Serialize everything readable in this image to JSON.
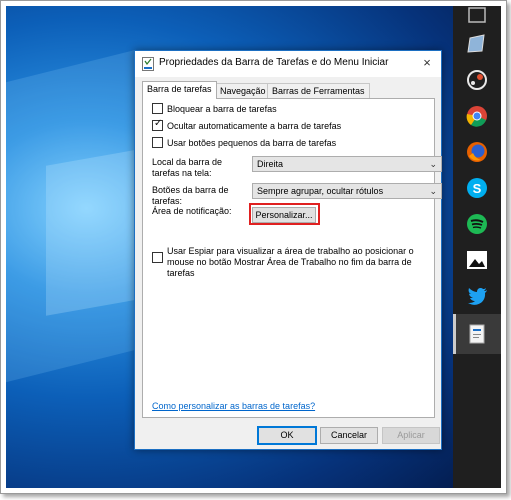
{
  "dialog": {
    "title": "Propriedades da Barra de Tarefas e do Menu Iniciar",
    "close_glyph": "×",
    "tabs": [
      {
        "label": "Barra de tarefas",
        "active": true
      },
      {
        "label": "Navegação",
        "active": false
      },
      {
        "label": "Barras de Ferramentas",
        "active": false
      }
    ],
    "options": {
      "lock": {
        "label": "Bloquear a barra de tarefas",
        "checked": false
      },
      "autohide": {
        "label": "Ocultar automaticamente a barra de tarefas",
        "checked": true
      },
      "small_buttons": {
        "label": "Usar botões pequenos da barra de tarefas",
        "checked": false
      }
    },
    "location": {
      "label": "Local da barra de tarefas na tela:",
      "value": "Direita"
    },
    "buttons_combine": {
      "label": "Botões da barra de tarefas:",
      "value": "Sempre agrupar, ocultar rótulos"
    },
    "notification": {
      "label": "Área de notificação:",
      "button": "Personalizar..."
    },
    "peek": {
      "label": "Usar Espiar para visualizar a área de trabalho ao posicionar o mouse no botão Mostrar Área de Trabalho no fim da barra de tarefas",
      "checked": false
    },
    "help_link": "Como personalizar as barras de tarefas?",
    "footer": {
      "ok": "OK",
      "cancel": "Cancelar",
      "apply": "Aplicar"
    }
  },
  "taskbar_icons": [
    "window-icon",
    "app-icon",
    "steam-icon",
    "chrome-icon",
    "firefox-icon",
    "skype-icon",
    "spotify-icon",
    "photos-icon",
    "twitter-icon",
    "taskbar-properties-icon"
  ],
  "colors": {
    "accent": "#0078d7",
    "highlight_box": "#e02020",
    "link": "#0066cc"
  }
}
